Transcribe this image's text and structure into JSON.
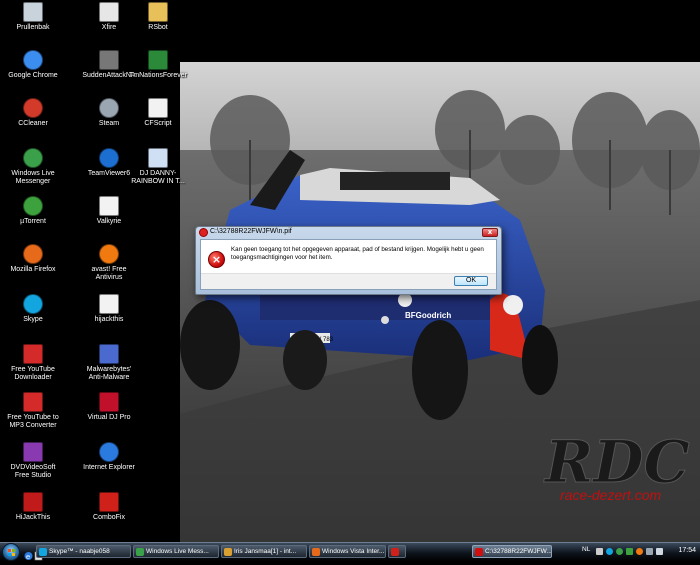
{
  "desktop": {
    "icons": [
      {
        "label": "Prullenbak",
        "icon": "recycle-bin-icon",
        "color": "#c9d3dc"
      },
      {
        "label": "Xfire",
        "icon": "xfire-icon",
        "color": "#e6e6e6"
      },
      {
        "label": "RSbot",
        "icon": "folder-icon",
        "color": "#e8c05a"
      },
      {
        "label": "Google Chrome",
        "icon": "chrome-icon",
        "color": "#3c8df0"
      },
      {
        "label": "SuddenAttackNA",
        "icon": "game-icon",
        "color": "#777777"
      },
      {
        "label": "TmNationsForever",
        "icon": "game-icon",
        "color": "#2a8a3a"
      },
      {
        "label": "CCleaner",
        "icon": "ccleaner-icon",
        "color": "#d33a2a"
      },
      {
        "label": "Steam",
        "icon": "steam-icon",
        "color": "#9aa6b2"
      },
      {
        "label": "CFScript",
        "icon": "document-icon",
        "color": "#f2f2f2"
      },
      {
        "label": "Windows Live Messenger",
        "icon": "messenger-icon",
        "color": "#3aa04a"
      },
      {
        "label": "TeamViewer6",
        "icon": "teamviewer-icon",
        "color": "#1c6fd0"
      },
      {
        "label": "DJ DANNY-RAINBOW IN T...",
        "icon": "audio-file-icon",
        "color": "#cfe0f5"
      },
      {
        "label": "µTorrent",
        "icon": "utorrent-icon",
        "color": "#3da23d"
      },
      {
        "label": "Valkyrie",
        "icon": "document-icon",
        "color": "#f2f2f2"
      },
      {
        "label": "Mozilla Firefox",
        "icon": "firefox-icon",
        "color": "#e66a1a"
      },
      {
        "label": "avast! Free Antivirus",
        "icon": "avast-icon",
        "color": "#f07a10"
      },
      {
        "label": "Skype",
        "icon": "skype-icon",
        "color": "#12a5e0"
      },
      {
        "label": "hijackthis",
        "icon": "document-icon",
        "color": "#f2f2f2"
      },
      {
        "label": "Free YouTube Downloader",
        "icon": "youtube-downloader-icon",
        "color": "#d42a2a"
      },
      {
        "label": "Malwarebytes' Anti-Malware",
        "icon": "malwarebytes-icon",
        "color": "#4a6ad0"
      },
      {
        "label": "Free YouTube to MP3 Converter",
        "icon": "youtube-mp3-icon",
        "color": "#d42a2a"
      },
      {
        "label": "Virtual DJ Pro",
        "icon": "virtualdj-icon",
        "color": "#c0102a"
      },
      {
        "label": "DVDVideoSoft Free Studio",
        "icon": "dvdvideosoft-icon",
        "color": "#8a3ab0"
      },
      {
        "label": "Internet Explorer",
        "icon": "ie-icon",
        "color": "#2a7ae0"
      },
      {
        "label": "HiJackThis",
        "icon": "hijackthis-icon",
        "color": "#c01a1a"
      },
      {
        "label": "ComboFix",
        "icon": "combofix-icon",
        "color": "#d0201a"
      }
    ]
  },
  "dialog": {
    "title": "C:\\32788R22FWJFW\\n.pif",
    "close_label": "x",
    "message": "Kan geen toegang tot het opgegeven apparaat, pad of bestand krijgen. Mogelijk hebt u geen toegangsmachtigingen voor het item.",
    "ok_label": "OK"
  },
  "wallpaper": {
    "logo_text": "RDC",
    "logo_url_text": "race-dezert.com",
    "plate_text": "WOB - VW 783",
    "sponsor_text": "BFGoodrich"
  },
  "taskbar": {
    "buttons": [
      {
        "label": "Skype™ - naabje058",
        "icon": "skype-icon",
        "color": "#12a5e0"
      },
      {
        "label": "Windows Live Mess...",
        "icon": "messenger-icon",
        "color": "#3aa04a"
      },
      {
        "label": "Iris Jansmaa[1] - int...",
        "icon": "image-icon",
        "color": "#d8a030"
      },
      {
        "label": "Windows Vista Inter...",
        "icon": "firefox-icon",
        "color": "#e66a1a"
      },
      {
        "label": "",
        "icon": "combofix-icon",
        "color": "#d0201a"
      },
      {
        "label": "C:\\32788R22FWJFW...",
        "icon": "error-icon",
        "color": "#d01010"
      }
    ],
    "tray_language": "NL",
    "clock": "17:54"
  },
  "colors": {
    "accent": "#2b6ea8",
    "error": "#d01010"
  }
}
